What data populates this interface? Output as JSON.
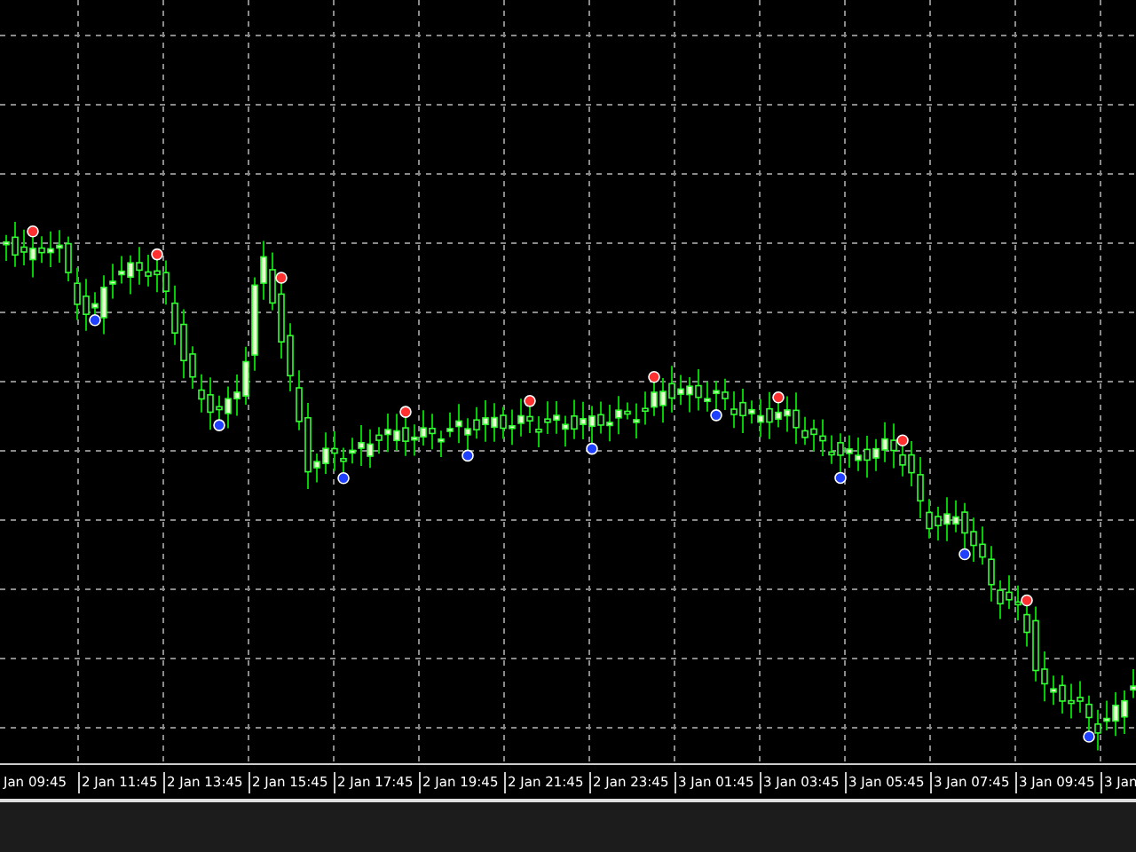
{
  "chart": {
    "time_axis_labels": [
      "Jan 09:45",
      "2 Jan 11:45",
      "2 Jan 13:45",
      "2 Jan 15:45",
      "2 Jan 17:45",
      "2 Jan 19:45",
      "2 Jan 21:45",
      "2 Jan 23:45",
      "3 Jan 01:45",
      "3 Jan 03:45",
      "3 Jan 05:45",
      "3 Jan 07:45",
      "3 Jan 09:45",
      "3 Jan"
    ]
  }
}
